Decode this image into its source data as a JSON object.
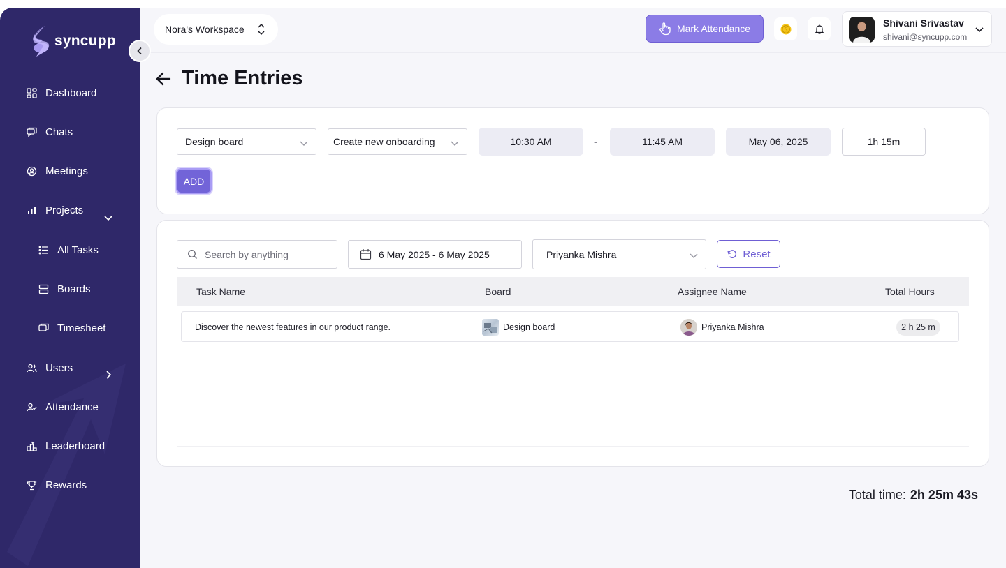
{
  "app": {
    "brand": "syncupp",
    "colors": {
      "sidebar": "#2f2869",
      "accent": "#7264d8",
      "mark_attendance": "#8b7ce6"
    }
  },
  "sidebar": {
    "items": [
      {
        "label": "Dashboard",
        "icon": "dashboard-icon"
      },
      {
        "label": "Chats",
        "icon": "chat-icon"
      },
      {
        "label": "Meetings",
        "icon": "meetings-icon"
      },
      {
        "label": "Projects",
        "icon": "projects-icon",
        "expanded": true
      },
      {
        "label": "All Tasks",
        "icon": "list-icon"
      },
      {
        "label": "Boards",
        "icon": "boards-icon"
      },
      {
        "label": "Timesheet",
        "icon": "timesheet-icon"
      },
      {
        "label": "Users",
        "icon": "users-icon"
      },
      {
        "label": "Attendance",
        "icon": "attendance-icon"
      },
      {
        "label": "Leaderboard",
        "icon": "leaderboard-icon"
      },
      {
        "label": "Rewards",
        "icon": "trophy-icon"
      }
    ]
  },
  "header": {
    "workspace": "Nora's Workspace",
    "mark_attendance": "Mark Attendance",
    "user": {
      "name": "Shivani Srivastav",
      "email": "shivani@syncupp.com"
    }
  },
  "page": {
    "title": "Time Entries"
  },
  "entry_form": {
    "board": "Design board",
    "task": "Create new onboarding",
    "start_time": "10:30 AM",
    "separator": "-",
    "end_time": "11:45 AM",
    "date": "May 06, 2025",
    "duration": "1h 15m",
    "add_label": "ADD"
  },
  "filters": {
    "search_placeholder": "Search by anything",
    "date_range": "6 May 2025 - 6 May 2025",
    "assignee": "Priyanka Mishra",
    "reset_label": "Reset"
  },
  "table": {
    "columns": [
      "Task Name",
      "Board",
      "Assignee Name",
      "Total Hours"
    ],
    "rows": [
      {
        "task": "Discover the newest features in our product range.",
        "board": "Design board",
        "assignee": "Priyanka Mishra",
        "hours": "2 h 25 m"
      }
    ]
  },
  "footer": {
    "total_label": "Total time:",
    "total_value": "2h 25m 43s"
  }
}
